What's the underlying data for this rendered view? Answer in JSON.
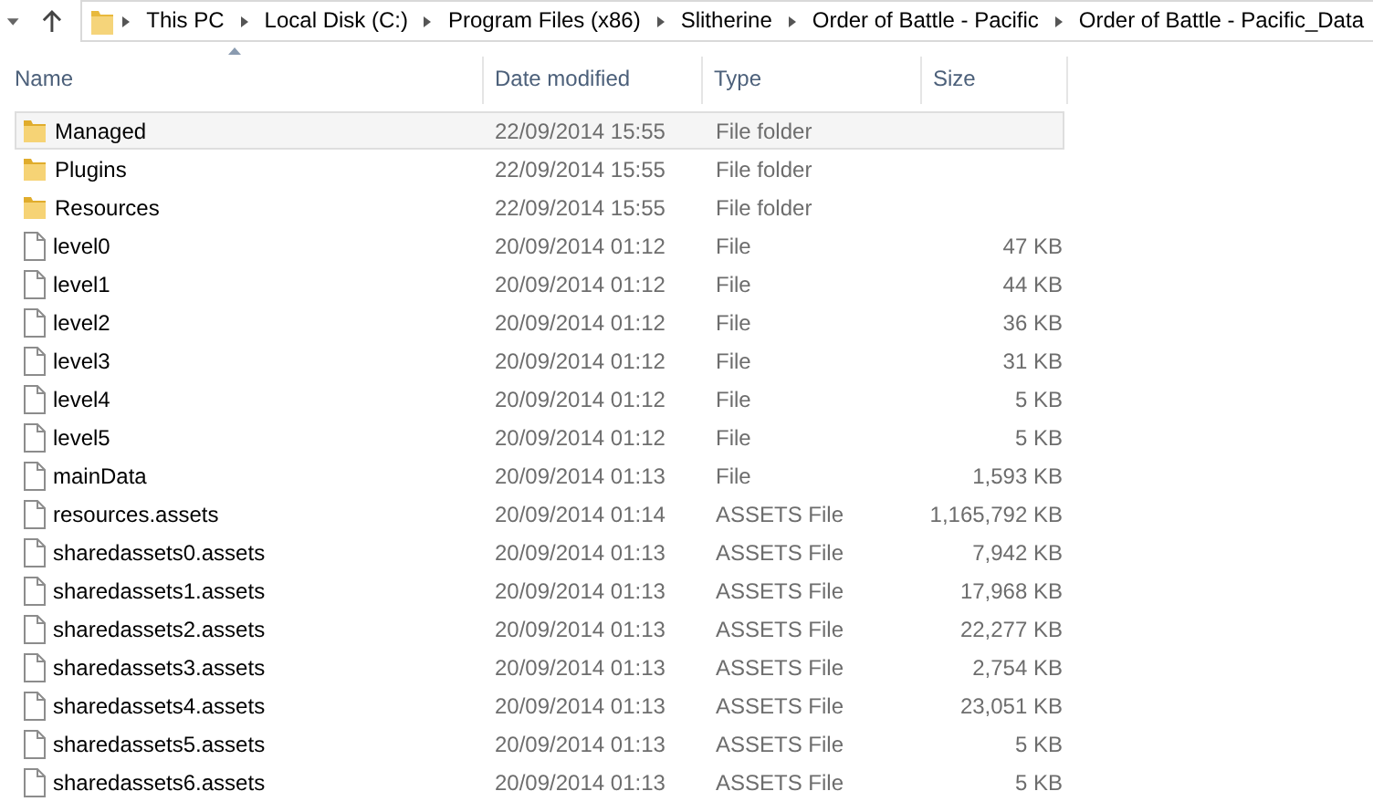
{
  "breadcrumb": [
    "This PC",
    "Local Disk (C:)",
    "Program Files (x86)",
    "Slitherine",
    "Order of Battle - Pacific",
    "Order of Battle - Pacific_Data"
  ],
  "columns": [
    "Name",
    "Date modified",
    "Type",
    "Size"
  ],
  "rows": [
    {
      "kind": "folder",
      "name": "Managed",
      "date": "22/09/2014 15:55",
      "type": "File folder",
      "selected": true
    },
    {
      "kind": "folder",
      "name": "Plugins",
      "date": "22/09/2014 15:55",
      "type": "File folder",
      "selected": false
    },
    {
      "kind": "folder",
      "name": "Resources",
      "date": "22/09/2014 15:55",
      "type": "File folder",
      "selected": false
    },
    {
      "kind": "file",
      "name": "level0",
      "date": "20/09/2014 01:12",
      "type": "File",
      "size": "47 KB",
      "selected": false
    },
    {
      "kind": "file",
      "name": "level1",
      "date": "20/09/2014 01:12",
      "type": "File",
      "size": "44 KB",
      "selected": false
    },
    {
      "kind": "file",
      "name": "level2",
      "date": "20/09/2014 01:12",
      "type": "File",
      "size": "36 KB",
      "selected": false
    },
    {
      "kind": "file",
      "name": "level3",
      "date": "20/09/2014 01:12",
      "type": "File",
      "size": "31 KB",
      "selected": false
    },
    {
      "kind": "file",
      "name": "level4",
      "date": "20/09/2014 01:12",
      "type": "File",
      "size": "5 KB",
      "selected": false
    },
    {
      "kind": "file",
      "name": "level5",
      "date": "20/09/2014 01:12",
      "type": "File",
      "size": "5 KB",
      "selected": false
    },
    {
      "kind": "file",
      "name": "mainData",
      "date": "20/09/2014 01:13",
      "type": "File",
      "size": "1,593 KB",
      "selected": false
    },
    {
      "kind": "file",
      "name": "resources.assets",
      "date": "20/09/2014 01:14",
      "type": "ASSETS File",
      "size": "1,165,792 KB",
      "selected": false
    },
    {
      "kind": "file",
      "name": "sharedassets0.assets",
      "date": "20/09/2014 01:13",
      "type": "ASSETS File",
      "size": "7,942 KB",
      "selected": false
    },
    {
      "kind": "file",
      "name": "sharedassets1.assets",
      "date": "20/09/2014 01:13",
      "type": "ASSETS File",
      "size": "17,968 KB",
      "selected": false
    },
    {
      "kind": "file",
      "name": "sharedassets2.assets",
      "date": "20/09/2014 01:13",
      "type": "ASSETS File",
      "size": "22,277 KB",
      "selected": false
    },
    {
      "kind": "file",
      "name": "sharedassets3.assets",
      "date": "20/09/2014 01:13",
      "type": "ASSETS File",
      "size": "2,754 KB",
      "selected": false
    },
    {
      "kind": "file",
      "name": "sharedassets4.assets",
      "date": "20/09/2014 01:13",
      "type": "ASSETS File",
      "size": "23,051 KB",
      "selected": false
    },
    {
      "kind": "file",
      "name": "sharedassets5.assets",
      "date": "20/09/2014 01:13",
      "type": "ASSETS File",
      "size": "5 KB",
      "selected": false
    },
    {
      "kind": "file",
      "name": "sharedassets6.assets",
      "date": "20/09/2014 01:13",
      "type": "ASSETS File",
      "size": "5 KB",
      "selected": false
    }
  ]
}
